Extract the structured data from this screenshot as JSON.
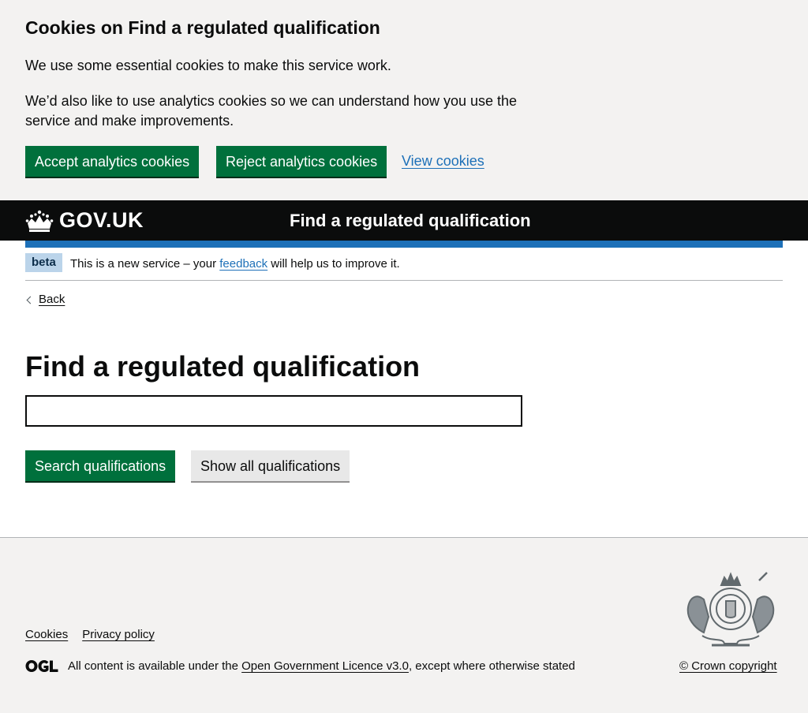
{
  "cookie_banner": {
    "heading": "Cookies on Find a regulated qualification",
    "paragraph_1": "We use some essential cookies to make this service work.",
    "paragraph_2": "We’d also like to use analytics cookies so we can understand how you use the service and make improvements.",
    "accept_label": "Accept analytics cookies",
    "reject_label": "Reject analytics cookies",
    "view_label": "View cookies"
  },
  "header": {
    "logo_text": "GOV.UK",
    "service_name": "Find a regulated qualification"
  },
  "phase_banner": {
    "tag": "beta",
    "text_before": "This is a new service – your ",
    "link_text": "feedback",
    "text_after": " will help us to improve it."
  },
  "back_link": "Back",
  "main": {
    "title": "Find a regulated qualification",
    "search_value": "",
    "search_button": "Search qualifications",
    "show_all_button": "Show all qualifications"
  },
  "footer": {
    "links": [
      "Cookies",
      "Privacy policy"
    ],
    "licence_before": "All content is available under the ",
    "licence_link": "Open Government Licence v3.0",
    "licence_after": ", except where otherwise stated",
    "copyright": "© Crown copyright"
  },
  "colors": {
    "brand_green": "#00703c",
    "link_blue": "#1d70b8",
    "header_black": "#0b0c0c",
    "banner_grey": "#f3f2f1"
  }
}
